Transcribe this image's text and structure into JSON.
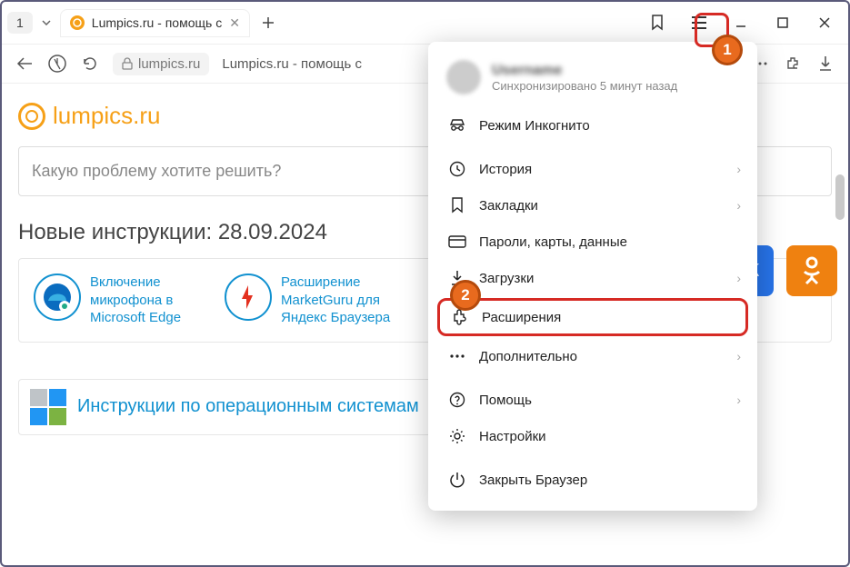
{
  "titlebar": {
    "group_count": "1",
    "tab_title": "Lumpics.ru - помощь с"
  },
  "addrbar": {
    "domain": "lumpics.ru",
    "title": "Lumpics.ru - помощь с"
  },
  "page": {
    "brand": "lumpics.ru",
    "search_placeholder": "Какую проблему хотите решить?",
    "heading": "Новые инструкции: 28.09.2024",
    "card1": "Включение микрофона в Microsoft Edge",
    "card2": "Расширение MarketGuru для Яндекс Браузера",
    "os_block": "Инструкции по операционным системам"
  },
  "menu": {
    "user_name": "Username",
    "user_sub": "Синхронизировано 5 минут назад",
    "items": {
      "incognito": "Режим Инкогнито",
      "history": "История",
      "bookmarks": "Закладки",
      "passwords": "Пароли, карты, данные",
      "downloads": "Загрузки",
      "extensions": "Расширения",
      "more": "Дополнительно",
      "help": "Помощь",
      "settings": "Настройки",
      "close": "Закрыть Браузер"
    }
  },
  "callouts": {
    "one": "1",
    "two": "2"
  }
}
